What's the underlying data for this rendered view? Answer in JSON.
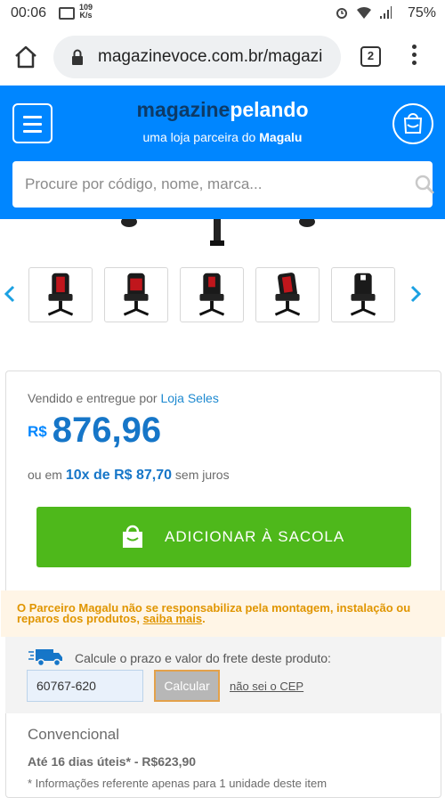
{
  "status": {
    "time": "00:06",
    "speed_value": "109",
    "speed_unit": "K/s",
    "battery": "75%"
  },
  "browser": {
    "url": "magazinevoce.com.br/magazi",
    "tab_count": "2"
  },
  "header": {
    "logo_part1": "magazine",
    "logo_part2": "pelando",
    "tagline_prefix": "uma loja parceira do ",
    "tagline_brand": "Magalu",
    "search_placeholder": "Procure por código, nome, marca..."
  },
  "colors": {
    "brand_blue": "#0086ff",
    "cta_green": "#4eb81b",
    "price_blue": "#1676c8",
    "warning_orange": "#e09500"
  },
  "thumbnails_count": 5,
  "buybox": {
    "seller_prefix": "Vendido e entregue por ",
    "seller_name": "Loja Seles",
    "currency": "R$",
    "price": "876,96",
    "installment_prefix": "ou em ",
    "installment_value": "10x de R$ 87,70",
    "installment_suffix": " sem juros",
    "add_button_label": "ADICIONAR À SACOLA",
    "warning_text": "O Parceiro Magalu não se responsabiliza pela montagem, instalação ou reparos dos produtos, ",
    "warning_link": "saiba mais",
    "warning_end": ".",
    "freight_label": "Calcule o prazo e valor do frete deste produto:",
    "cep_value": "60767-620",
    "calc_label": "Calcular",
    "nocep_label": "não sei o CEP",
    "shipping_title": "Convencional",
    "shipping_line": "Até 16 dias úteis* - R$623,90",
    "shipping_note": "* Informações referente apenas para 1 unidade deste item"
  }
}
